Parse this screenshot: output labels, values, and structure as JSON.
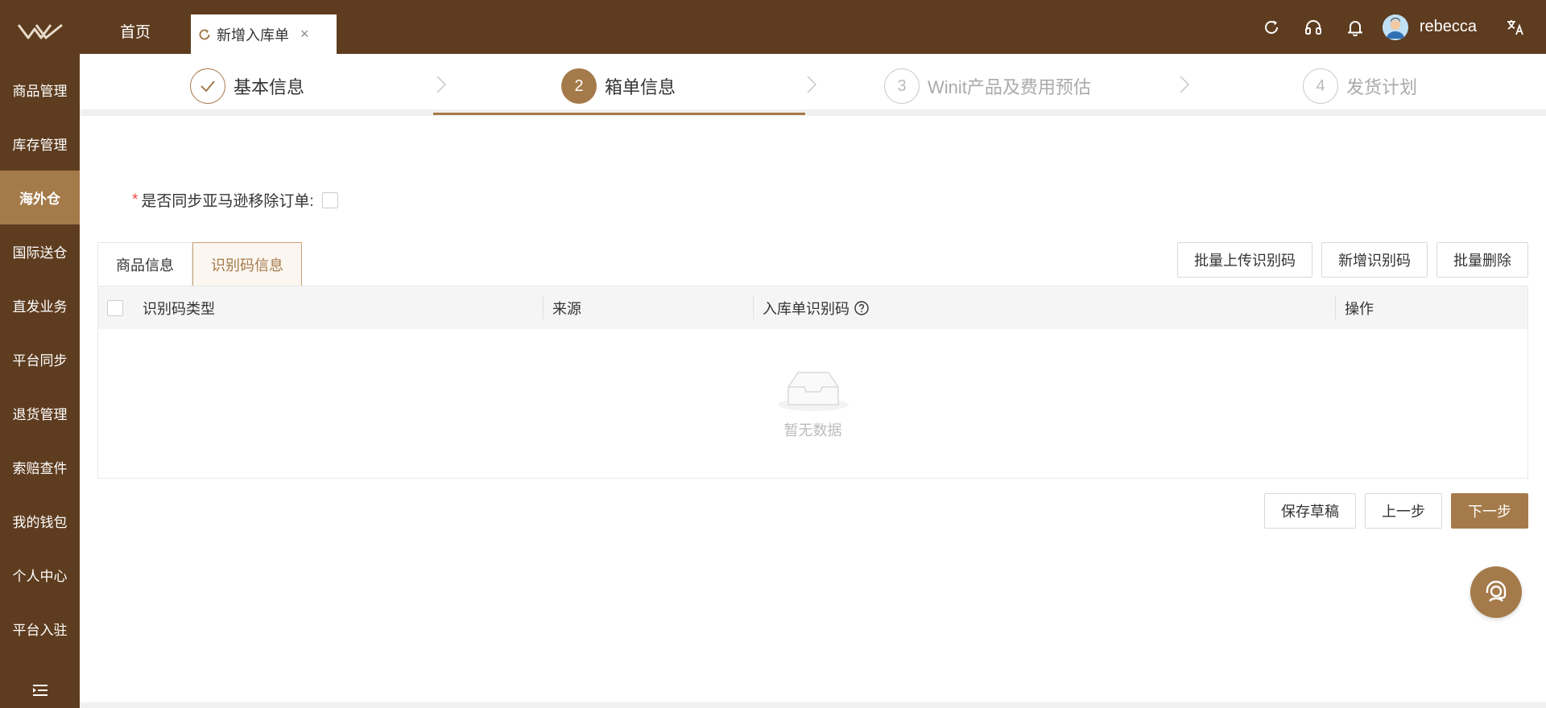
{
  "colors": {
    "brand_dark": "#5e3c1f",
    "brand_accent": "#a57a4a",
    "required": "#e44444"
  },
  "sidebar": {
    "items": [
      {
        "label": "商品管理"
      },
      {
        "label": "库存管理"
      },
      {
        "label": "海外仓",
        "active": true
      },
      {
        "label": "国际送仓"
      },
      {
        "label": "直发业务"
      },
      {
        "label": "平台同步"
      },
      {
        "label": "退货管理"
      },
      {
        "label": "索赔查件"
      },
      {
        "label": "我的钱包"
      },
      {
        "label": "个人中心"
      },
      {
        "label": "平台入驻"
      }
    ],
    "collapse_icon": "collapse-menu-icon"
  },
  "header": {
    "tabs": {
      "home": "首页",
      "active": "新增入库单",
      "close": "×"
    },
    "icons": [
      "refresh-icon",
      "headset-icon",
      "bell-icon",
      "translate-icon"
    ],
    "user": {
      "name": "rebecca"
    }
  },
  "steps": [
    {
      "index": "1",
      "label": "基本信息",
      "state": "done"
    },
    {
      "index": "2",
      "label": "箱单信息",
      "state": "current"
    },
    {
      "index": "3",
      "label": "Winit产品及费用预估",
      "state": "pending"
    },
    {
      "index": "4",
      "label": "发货计划",
      "state": "pending"
    }
  ],
  "form": {
    "sync_required_mark": "*",
    "sync_label": "是否同步亚马逊移除订单:",
    "sync_checked": false
  },
  "subtabs": [
    {
      "label": "商品信息",
      "active": false
    },
    {
      "label": "识别码信息",
      "active": true
    }
  ],
  "toolbar": {
    "batch_upload": "批量上传识别码",
    "add_code": "新增识别码",
    "batch_delete": "批量删除"
  },
  "table": {
    "columns": [
      "识别码类型",
      "来源",
      "入库单识别码",
      "操作"
    ],
    "rows": [],
    "empty_text": "暂无数据"
  },
  "footer": {
    "save_draft": "保存草稿",
    "prev": "上一步",
    "next": "下一步"
  }
}
